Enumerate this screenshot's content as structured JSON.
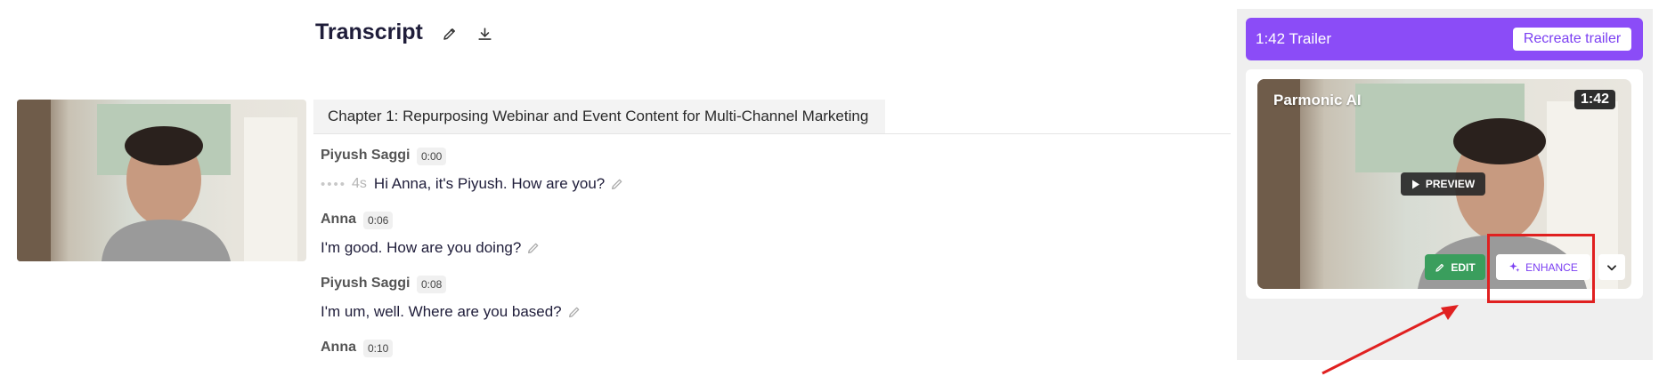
{
  "transcript": {
    "title": "Transcript",
    "chapter_title": "Chapter 1: Repurposing Webinar and Event Content for Multi-Channel Marketing",
    "entries": [
      {
        "speaker": "Piyush Saggi",
        "timestamp": "0:00",
        "gap": "4s",
        "text": "Hi Anna, it's Piyush. How are you?"
      },
      {
        "speaker": "Anna",
        "timestamp": "0:06",
        "text": "I'm good. How are you doing?"
      },
      {
        "speaker": "Piyush Saggi",
        "timestamp": "0:08",
        "text": "I'm um, well. Where are you based?"
      },
      {
        "speaker": "Anna",
        "timestamp": "0:10"
      }
    ]
  },
  "trailer": {
    "label": "1:42 Trailer",
    "recreate_label": "Recreate trailer",
    "brand": "Parmonic AI",
    "duration": "1:42",
    "preview_label": "PREVIEW",
    "edit_label": "EDIT",
    "enhance_label": "ENHANCE"
  },
  "colors": {
    "accent": "#8b4cf7",
    "edit_green": "#3a9e5d",
    "highlight_red": "#e02020"
  },
  "icons": [
    "pencil-icon",
    "download-icon",
    "play-icon",
    "sparkle-icon",
    "chevron-down-icon"
  ]
}
